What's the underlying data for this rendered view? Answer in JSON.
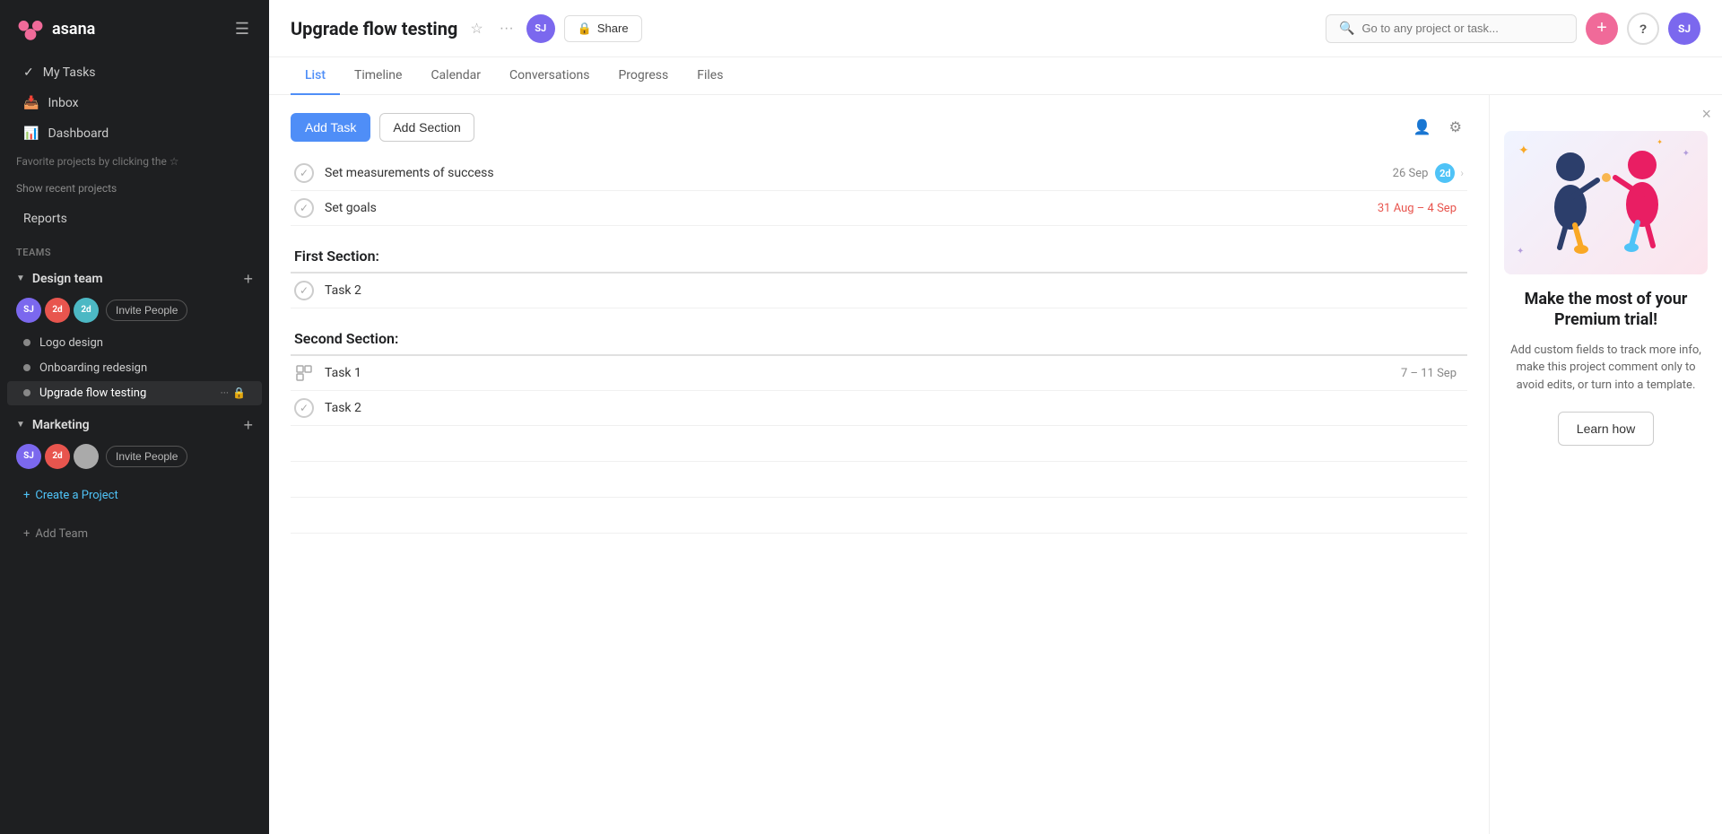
{
  "app": {
    "name": "asana",
    "logo_text": "asana"
  },
  "sidebar": {
    "nav_items": [
      {
        "id": "my-tasks",
        "label": "My Tasks",
        "icon": "✓"
      },
      {
        "id": "inbox",
        "label": "Inbox",
        "icon": "📥"
      },
      {
        "id": "dashboard",
        "label": "Dashboard",
        "icon": "📊"
      }
    ],
    "favorites_hint": "Favorite projects by clicking the ☆",
    "show_recent": "Show recent projects",
    "reports_label": "Reports",
    "teams_section_label": "Teams",
    "teams": [
      {
        "id": "design-team",
        "name": "Design team",
        "members": [
          {
            "initials": "SJ",
            "color": "#7b68ee"
          },
          {
            "initials": "2d",
            "color": "#e8554e"
          },
          {
            "initials": "2d",
            "color": "#4cb8c4"
          }
        ],
        "invite_label": "Invite People",
        "projects": [
          {
            "id": "logo-design",
            "label": "Logo design",
            "dot_color": "#888",
            "active": false
          },
          {
            "id": "onboarding-redesign",
            "label": "Onboarding redesign",
            "dot_color": "#888",
            "active": false
          },
          {
            "id": "upgrade-flow-testing",
            "label": "Upgrade flow testing",
            "dot_color": "#888",
            "active": true
          }
        ]
      },
      {
        "id": "marketing",
        "name": "Marketing",
        "members": [
          {
            "initials": "SJ",
            "color": "#7b68ee"
          },
          {
            "initials": "2d",
            "color": "#e8554e"
          },
          {
            "initials": "?",
            "color": "#aaa"
          }
        ],
        "invite_label": "Invite People",
        "projects": []
      }
    ],
    "create_project_label": "Create a Project",
    "add_team_label": "Add Team"
  },
  "topbar": {
    "project_title": "Upgrade flow testing",
    "share_label": "Share",
    "user_initials": "SJ",
    "search_placeholder": "Go to any project or task...",
    "add_btn_label": "+",
    "help_btn_label": "?"
  },
  "tabs": [
    {
      "id": "list",
      "label": "List",
      "active": true
    },
    {
      "id": "timeline",
      "label": "Timeline",
      "active": false
    },
    {
      "id": "calendar",
      "label": "Calendar",
      "active": false
    },
    {
      "id": "conversations",
      "label": "Conversations",
      "active": false
    },
    {
      "id": "progress",
      "label": "Progress",
      "active": false
    },
    {
      "id": "files",
      "label": "Files",
      "active": false
    }
  ],
  "toolbar": {
    "add_task_label": "Add Task",
    "add_section_label": "Add Section"
  },
  "tasks": [
    {
      "id": "t1",
      "name": "Set measurements of success",
      "type": "task",
      "date": "26 Sep",
      "badge": "2d",
      "has_subtasks": false,
      "overdue": false
    },
    {
      "id": "t2",
      "name": "Set goals",
      "type": "task",
      "date": "31 Aug – 4 Sep",
      "badge": null,
      "has_subtasks": false,
      "overdue": true
    }
  ],
  "sections": [
    {
      "id": "first-section",
      "title": "First Section:",
      "tasks": [
        {
          "id": "s1t1",
          "name": "Task 2",
          "type": "task",
          "date": null,
          "badge": null,
          "overdue": false
        }
      ]
    },
    {
      "id": "second-section",
      "title": "Second Section:",
      "tasks": [
        {
          "id": "s2t1",
          "name": "Task 1",
          "type": "subtask",
          "date": "7 – 11 Sep",
          "badge": null,
          "overdue": false
        },
        {
          "id": "s2t2",
          "name": "Task 2",
          "type": "task",
          "date": null,
          "badge": null,
          "overdue": false
        }
      ]
    }
  ],
  "premium_panel": {
    "title": "Make the most of your Premium trial!",
    "description": "Add custom fields to track more info, make this project comment only to avoid edits, or turn into a template.",
    "learn_how_label": "Learn how"
  }
}
